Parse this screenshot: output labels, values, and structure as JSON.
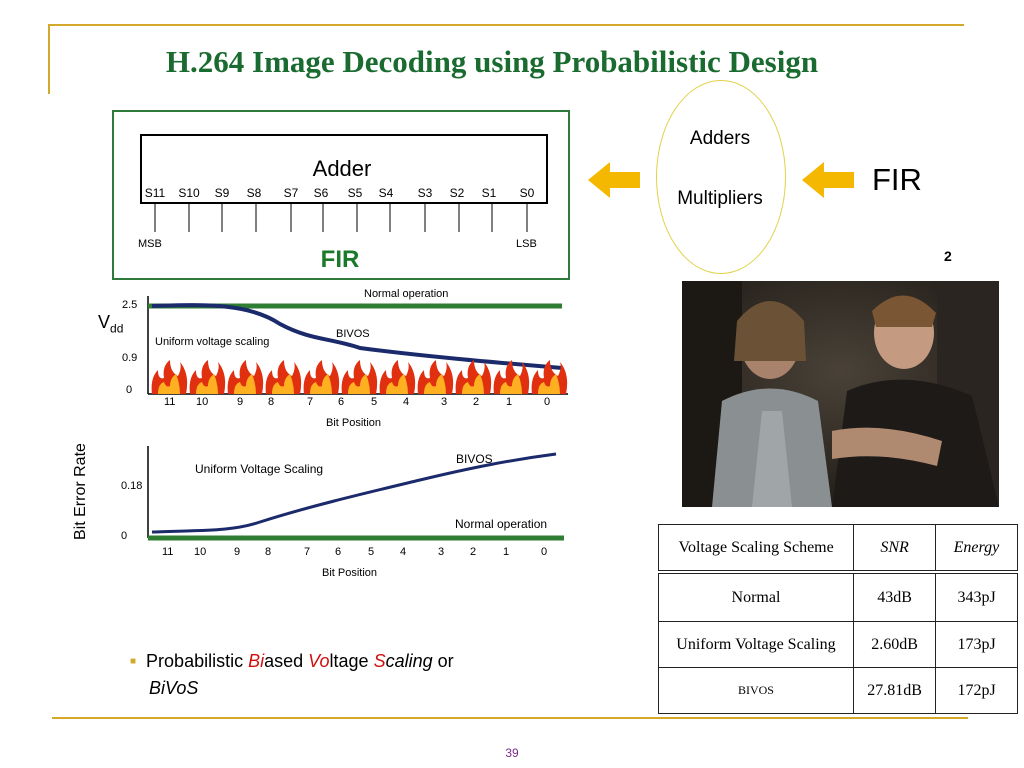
{
  "slide": {
    "title": "H.264 Image Decoding using Probabilistic Design",
    "page_number": "39"
  },
  "adder_diagram": {
    "title": "Adder",
    "bits": [
      "S11",
      "S10",
      "S9",
      "S8",
      "S7",
      "S6",
      "S5",
      "S4",
      "S3",
      "S2",
      "S1",
      "S0"
    ],
    "msb_label": "MSB",
    "lsb_label": "LSB",
    "caption": "FIR"
  },
  "flow": {
    "ellipse_top": "Adders",
    "ellipse_bottom": "Multipliers",
    "source_label": "FIR",
    "arrow_color": "#f4b800"
  },
  "photo_corner_digit": "2",
  "vdd_chart": {
    "ylabel_main": "V",
    "ylabel_sub": "dd",
    "y_ticks": [
      "2.5",
      "0.9",
      "0"
    ],
    "x_ticks": [
      "11",
      "10",
      "9",
      "8",
      "7",
      "6",
      "5",
      "4",
      "3",
      "2",
      "1",
      "0"
    ],
    "xlabel": "Bit Position",
    "labels": {
      "normal": "Normal  operation",
      "uniform": "Uniform voltage scaling",
      "bivos": "BIVOS"
    }
  },
  "ber_chart": {
    "ylabel": "Bit Error Rate",
    "y_ticks": [
      "0.18",
      "0"
    ],
    "x_ticks": [
      "11",
      "10",
      "9",
      "8",
      "7",
      "6",
      "5",
      "4",
      "3",
      "2",
      "1",
      "0"
    ],
    "xlabel": "Bit Position",
    "labels": {
      "uniform": "Uniform Voltage Scaling",
      "bivos": "BIVOS",
      "normal": "Normal  operation"
    }
  },
  "table": {
    "headers": [
      "Voltage Scaling Scheme",
      "SNR",
      "Energy"
    ],
    "rows": [
      [
        "Normal",
        "43dB",
        "343pJ"
      ],
      [
        "Uniform Voltage Scaling",
        "2.60dB",
        "173pJ"
      ],
      [
        "BIVOS",
        "27.81dB",
        "172pJ"
      ]
    ]
  },
  "bullet": {
    "p1": "Probabilistic ",
    "bi": "Bi",
    "p2": "ased ",
    "vo": "Vo",
    "p3": "ltage ",
    "s": "S",
    "caling": "caling",
    "p4": " or",
    "bivos": "BiVoS"
  },
  "colors": {
    "title": "#1a6b2f",
    "normal_line": "#2e7d32",
    "curve": "#1b2a6b",
    "accent_gold": "#d4a92a"
  }
}
